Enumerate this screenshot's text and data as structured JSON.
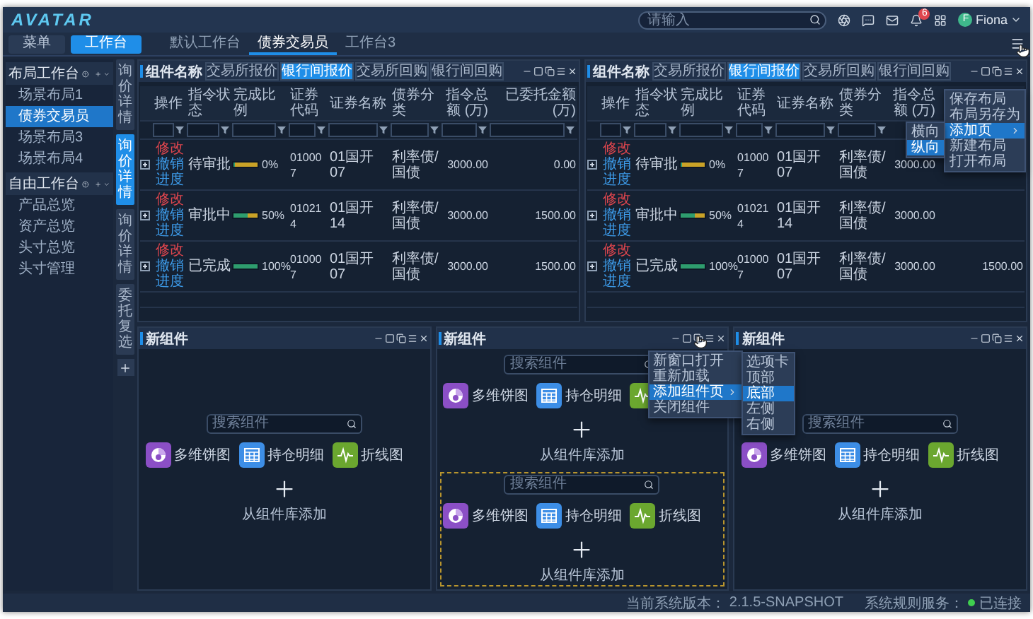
{
  "app": {
    "logo": "AVATAR",
    "search": {
      "placeholder": "请输入"
    },
    "notifications": "6",
    "user": {
      "initial": "F",
      "name": "Fiona"
    }
  },
  "nav": {
    "buttons": [
      {
        "label": "菜单",
        "selected": false
      },
      {
        "label": "工作台",
        "selected": true
      }
    ],
    "tabs": [
      {
        "label": "默认工作台",
        "selected": false
      },
      {
        "label": "债券交易员",
        "selected": true
      },
      {
        "label": "工作台3",
        "selected": false
      }
    ]
  },
  "sidebar": {
    "groups": [
      {
        "title": "布局工作台",
        "expanded": true,
        "items": [
          {
            "label": "场景布局1",
            "selected": false
          },
          {
            "label": "债券交易员",
            "selected": true
          },
          {
            "label": "场景布局3",
            "selected": false
          },
          {
            "label": "场景布局4",
            "selected": false
          }
        ]
      },
      {
        "title": "自由工作台",
        "expanded": true,
        "items": [
          {
            "label": "产品总览",
            "selected": false
          },
          {
            "label": "资产总览",
            "selected": false
          },
          {
            "label": "头寸总览",
            "selected": false
          },
          {
            "label": "头寸管理",
            "selected": false
          }
        ]
      }
    ]
  },
  "side_tabs": [
    {
      "label": "询价详情",
      "selected": false
    },
    {
      "label": "询价详情",
      "selected": true
    },
    {
      "label": "询价详情",
      "selected": false
    },
    {
      "label": "委托复选",
      "selected": false
    }
  ],
  "top_panels": [
    {
      "title": "组件名称",
      "tabs": [
        {
          "label": "交易所报价",
          "selected": false
        },
        {
          "label": "银行间报价",
          "selected": true
        },
        {
          "label": "交易所回购",
          "selected": false
        },
        {
          "label": "银行间回购",
          "selected": false
        }
      ],
      "table": {
        "columns": [
          "操作",
          "指令状态",
          "完成比例",
          "证券代码",
          "证券名称",
          "债券分类",
          "指令总额 (万)",
          "已委托金额 (万)"
        ],
        "rows": [
          {
            "expanded": false,
            "actions": [
              {
                "label": "修改",
                "kind": "danger"
              },
              {
                "label": "撤销",
                "kind": "link"
              },
              {
                "label": "进度",
                "kind": "link"
              }
            ],
            "status": "待审批",
            "level": 0,
            "percent": "0%",
            "code": "010007",
            "name": "01国开07",
            "category": "利率债/国债",
            "total": "3000.00",
            "committed": "0.00"
          },
          {
            "expanded": false,
            "actions": [
              {
                "label": "修改",
                "kind": "danger"
              },
              {
                "label": "撤销",
                "kind": "link"
              },
              {
                "label": "进度",
                "kind": "link"
              }
            ],
            "status": "审批中",
            "level": 0.5,
            "percent": "50%",
            "code": "010214",
            "name": "01国开14",
            "category": "利率债/国债",
            "total": "3000.00",
            "committed": "1500.00"
          },
          {
            "expanded": false,
            "actions": [
              {
                "label": "修改",
                "kind": "danger"
              },
              {
                "label": "撤销",
                "kind": "link"
              },
              {
                "label": "进度",
                "kind": "link"
              }
            ],
            "status": "已完成",
            "level": 1,
            "percent": "100%",
            "code": "010007",
            "name": "01国开07",
            "category": "利率债/国债",
            "total": "3000.00",
            "committed": "1500.00"
          }
        ]
      }
    },
    {
      "title": "组件名称",
      "tabs": [
        {
          "label": "交易所报价",
          "selected": false
        },
        {
          "label": "银行间报价",
          "selected": true
        },
        {
          "label": "交易所回购",
          "selected": false
        },
        {
          "label": "银行间回购",
          "selected": false
        }
      ],
      "table": {
        "columns": [
          "操作",
          "指令状态",
          "完成比例",
          "证券代码",
          "证券名称",
          "债券分类",
          "指令总额 (万)"
        ],
        "rows": [
          {
            "expanded": false,
            "actions": [
              {
                "label": "修改",
                "kind": "danger"
              },
              {
                "label": "撤销",
                "kind": "link"
              },
              {
                "label": "进度",
                "kind": "link"
              }
            ],
            "status": "待审批",
            "level": 0,
            "percent": "0%",
            "code": "010007",
            "name": "01国开07",
            "category": "利率债/国债",
            "total": "3000.00"
          },
          {
            "expanded": false,
            "actions": [
              {
                "label": "修改",
                "kind": "danger"
              },
              {
                "label": "撤销",
                "kind": "link"
              },
              {
                "label": "进度",
                "kind": "link"
              }
            ],
            "status": "审批中",
            "level": 0.5,
            "percent": "50%",
            "code": "010214",
            "name": "01国开14",
            "category": "利率债/国债",
            "total": "3000.00"
          },
          {
            "expanded": false,
            "actions": [
              {
                "label": "修改",
                "kind": "danger"
              },
              {
                "label": "撤销",
                "kind": "link"
              },
              {
                "label": "进度",
                "kind": "link"
              }
            ],
            "status": "已完成",
            "level": 1,
            "percent": "100%",
            "code": "010007",
            "name": "01国开07",
            "category": "利率债/国债",
            "total": "3000.00",
            "committed": "1500.00"
          }
        ]
      },
      "menu": {
        "kind": "layout",
        "items": [
          {
            "label": "保存布局",
            "selected": false,
            "submenu": false
          },
          {
            "label": "布局另存为",
            "selected": false,
            "submenu": false
          },
          {
            "label": "添加页",
            "selected": true,
            "submenu": true
          },
          {
            "label": "新建布局",
            "selected": false,
            "submenu": false
          },
          {
            "label": "打开布局",
            "selected": false,
            "submenu": false
          }
        ],
        "submenu": [
          {
            "label": "横向",
            "selected": false
          },
          {
            "label": "纵向",
            "selected": true
          }
        ]
      }
    }
  ],
  "bottom_panels": [
    {
      "title": "新组件",
      "sections": [
        {
          "kind": "area",
          "search_placeholder": "搜索组件",
          "widgets": [
            {
              "kind": "pie",
              "label": "多维饼图",
              "color": "#8b4fc6"
            },
            {
              "kind": "table",
              "label": "持仓明细",
              "color": "#3d8ee6"
            },
            {
              "kind": "line",
              "label": "折线图",
              "color": "#6ba72f"
            }
          ],
          "add_label": "从组件库添加"
        }
      ]
    },
    {
      "title": "新组件",
      "sections": [
        {
          "kind": "area",
          "search_placeholder": "搜索组件",
          "widgets": [
            {
              "kind": "pie",
              "label": "多维饼图",
              "color": "#8b4fc6"
            },
            {
              "kind": "table",
              "label": "持仓明细",
              "color": "#3d8ee6"
            },
            {
              "kind": "line",
              "color": "#6ba72f"
            }
          ],
          "add_label": "从组件库添加"
        },
        {
          "kind": "drop_zone",
          "search_placeholder": "搜索组件",
          "widgets": [
            {
              "kind": "pie",
              "label": "多维饼图",
              "color": "#8b4fc6"
            },
            {
              "kind": "table",
              "label": "持仓明细",
              "color": "#3d8ee6"
            },
            {
              "kind": "line",
              "label": "折线图",
              "color": "#6ba72f"
            }
          ],
          "add_label": "从组件库添加"
        }
      ],
      "menu": {
        "kind": "component",
        "items": [
          {
            "label": "新窗口打开",
            "selected": false,
            "submenu": false
          },
          {
            "label": "重新加载",
            "selected": false,
            "submenu": false
          },
          {
            "label": "添加组件页",
            "selected": true,
            "submenu": true
          },
          {
            "label": "关闭组件",
            "selected": false,
            "submenu": false
          }
        ],
        "submenu": [
          {
            "label": "选项卡",
            "selected": false
          },
          {
            "label": "顶部",
            "selected": false
          },
          {
            "label": "底部",
            "selected": true
          },
          {
            "label": "左侧",
            "selected": false
          },
          {
            "label": "右侧",
            "selected": false
          }
        ]
      }
    },
    {
      "title": "新组件",
      "sections": [
        {
          "kind": "area",
          "search_placeholder": "搜索组件",
          "widgets": [
            {
              "kind": "pie",
              "label": "多维饼图",
              "color": "#8b4fc6"
            },
            {
              "kind": "table",
              "label": "持仓明细",
              "color": "#3d8ee6"
            },
            {
              "kind": "line",
              "label": "折线图",
              "color": "#6ba72f"
            }
          ],
          "add_label": "从组件库添加"
        }
      ]
    }
  ],
  "status_bar": {
    "version_label": "当前系统版本：",
    "version": "2.1.5-SNAPSHOT",
    "service_label": "系统规则服务：",
    "connected": true,
    "service_status": "已连接"
  }
}
